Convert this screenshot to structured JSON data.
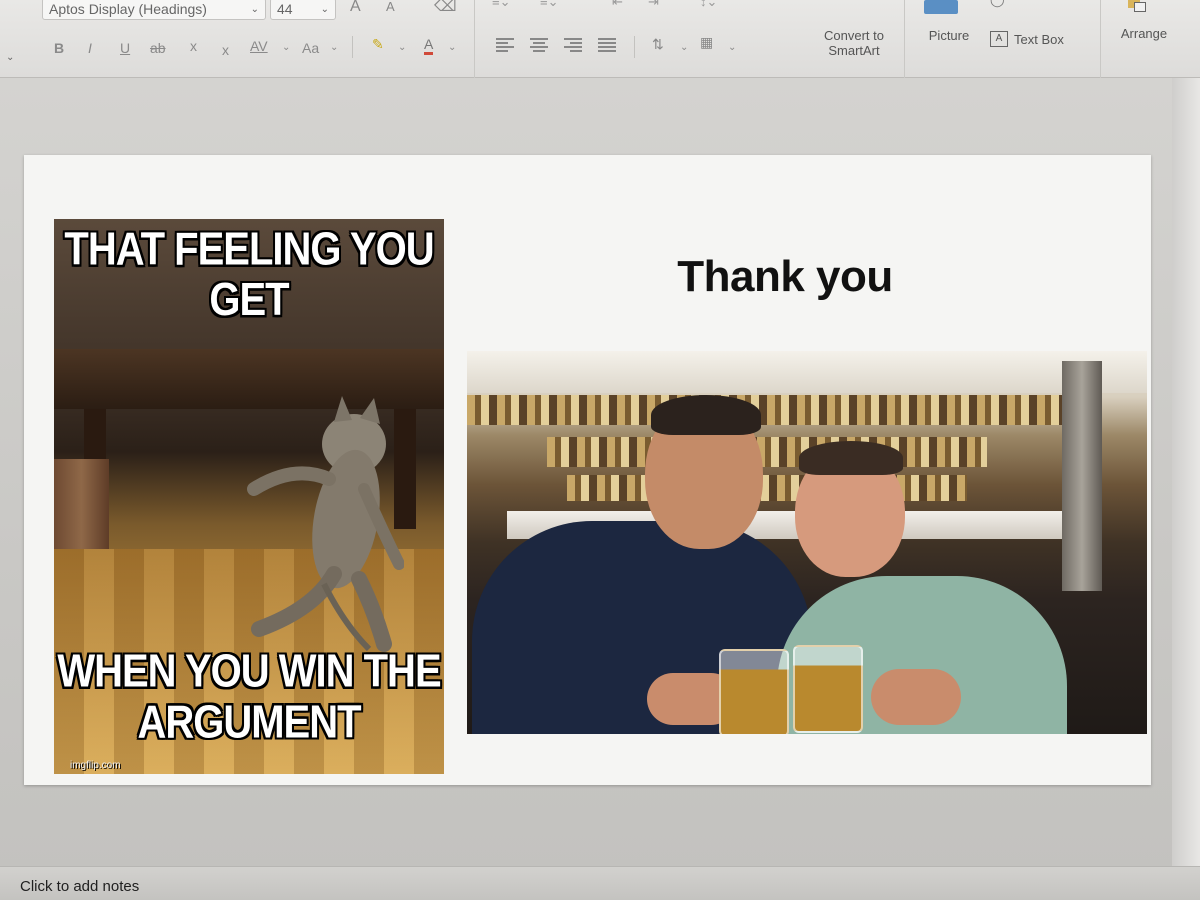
{
  "ribbon": {
    "font_name": "Aptos Display (Headings)",
    "font_size": "44",
    "grow_font": "A",
    "shrink_font": "A",
    "bold": "B",
    "italic": "I",
    "underline": "U",
    "strikethrough": "ab",
    "superscript": "x",
    "subscript": "x",
    "char_spacing": "AV",
    "change_case": "Aa",
    "font_color": "A",
    "convert_smartart": "Convert to SmartArt",
    "picture": "Picture",
    "text_box": "Text Box",
    "arrange": "Arrange",
    "textbox_icon_letter": "A"
  },
  "slide": {
    "title": "Thank you",
    "meme": {
      "top_text": "THAT FEELING YOU GET",
      "bottom_text": "WHEN YOU WIN THE ARGUMENT",
      "watermark": "imgflip.com"
    }
  },
  "notes": {
    "placeholder": "Click to add notes"
  },
  "colors": {
    "accent_picture": "#5a8fc4",
    "slide_bg": "#f5f5f3"
  },
  "icons": [
    "chevron-down-icon",
    "grow-font-icon",
    "shrink-font-icon",
    "clear-format-icon",
    "highlight-icon",
    "align-left-icon",
    "align-center-icon",
    "align-right-icon",
    "justify-icon",
    "text-direction-icon",
    "align-text-icon",
    "picture-icon",
    "textbox-icon",
    "arrange-icon"
  ]
}
